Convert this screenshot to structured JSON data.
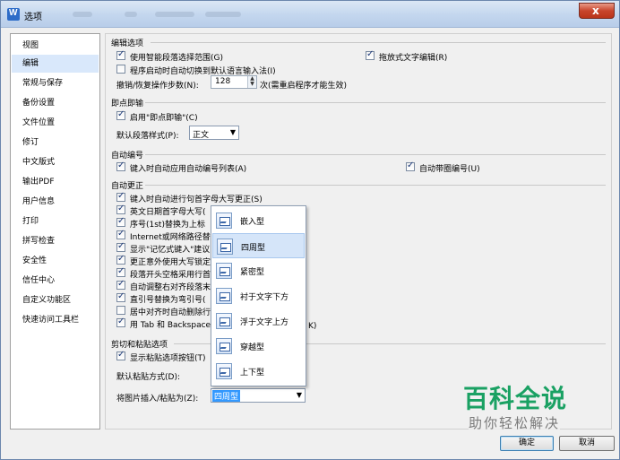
{
  "window": {
    "title": "选项",
    "close_glyph": "x"
  },
  "sidebar": {
    "items": [
      {
        "label": "视图"
      },
      {
        "label": "编辑"
      },
      {
        "label": "常规与保存"
      },
      {
        "label": "备份设置"
      },
      {
        "label": "文件位置"
      },
      {
        "label": "修订"
      },
      {
        "label": "中文版式"
      },
      {
        "label": "输出PDF"
      },
      {
        "label": "用户信息"
      },
      {
        "label": "打印"
      },
      {
        "label": "拼写检查"
      },
      {
        "label": "安全性"
      },
      {
        "label": "信任中心"
      },
      {
        "label": "自定义功能区"
      },
      {
        "label": "快速访问工具栏"
      }
    ],
    "active_index": 1
  },
  "edit_options": {
    "heading": "编辑选项",
    "smart_select": "使用智能段落选择范围(G)",
    "drag_text": "拖放式文字编辑(R)",
    "auto_ime": "程序启动时自动切换到默认语言输入法(I)",
    "undo_label": "撤销/恢复操作步数(N):",
    "undo_value": "128",
    "undo_suffix": "次(需重启程序才能生效)"
  },
  "instant_input": {
    "heading": "即点即输",
    "enable": "启用\"即点即输\"(C)",
    "style_label": "默认段落样式(P):",
    "style_value": "正文"
  },
  "auto_numbering": {
    "heading": "自动编号",
    "auto_list": "键入时自动应用自动编号列表(A)",
    "circle_num": "自动带圈编号(U)"
  },
  "auto_correct": {
    "heading": "自动更正",
    "items": [
      {
        "label": "键入时自动进行句首字母大写更正(S)",
        "checked": true
      },
      {
        "label": "英文日期首字母大写(",
        "checked": true
      },
      {
        "label": "序号(1st)替换为上标",
        "checked": true
      },
      {
        "label": "Internet或网络路径替",
        "checked": true
      },
      {
        "label": "显示\"记忆式键入\"建议",
        "checked": true
      },
      {
        "label": "更正意外使用大写锁定",
        "checked": true
      },
      {
        "label": "段落开头空格采用行首",
        "checked": true
      },
      {
        "label": "自动调整右对齐段落末",
        "checked": true
      },
      {
        "label": "直引号替换为弯引号(",
        "checked": true
      },
      {
        "label": "居中对齐时自动删除行",
        "checked": false
      },
      {
        "label": "用 Tab 和 Backspace",
        "checked": true
      }
    ],
    "tail_fragment": "K)"
  },
  "paste_options": {
    "heading": "剪切和粘贴选项",
    "show_button": "显示粘贴选项按钮(T)",
    "default_paste_label": "默认粘贴方式(D):",
    "insert_label": "将图片插入/粘贴为(Z):",
    "insert_value": "四周型"
  },
  "wrap_dropdown": {
    "options": [
      {
        "label": "嵌入型"
      },
      {
        "label": "四周型"
      },
      {
        "label": "紧密型"
      },
      {
        "label": "衬于文字下方"
      },
      {
        "label": "浮于文字上方"
      },
      {
        "label": "穿越型"
      },
      {
        "label": "上下型"
      }
    ],
    "selected_index": 1
  },
  "footer": {
    "ok": "确定",
    "cancel": "取消"
  },
  "watermark": {
    "main": "百科全说",
    "sub": "助你轻松解决"
  }
}
